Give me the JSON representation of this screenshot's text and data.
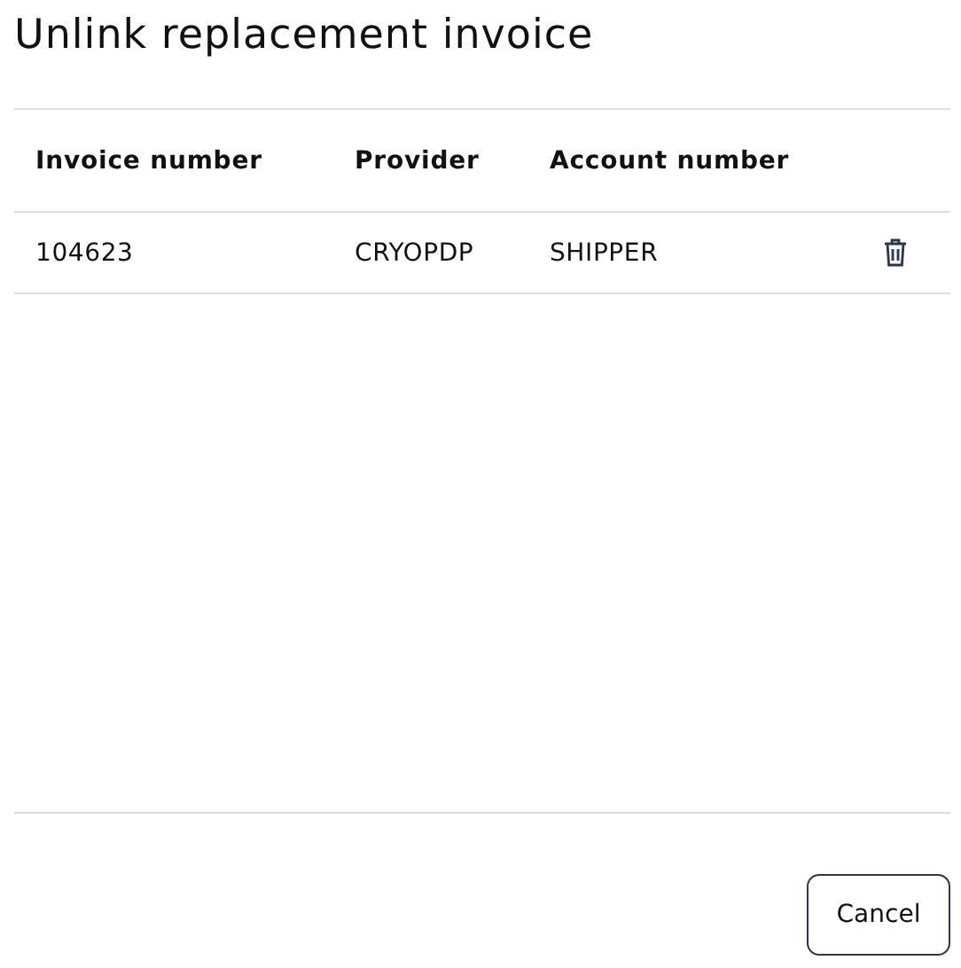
{
  "title": "Unlink replacement invoice",
  "table": {
    "columns": [
      "Invoice number",
      "Provider",
      "Account number"
    ],
    "rows": [
      {
        "cells": [
          "104623",
          "CRYOPDP",
          "SHIPPER"
        ]
      }
    ]
  },
  "buttons": [
    "Cancel"
  ]
}
